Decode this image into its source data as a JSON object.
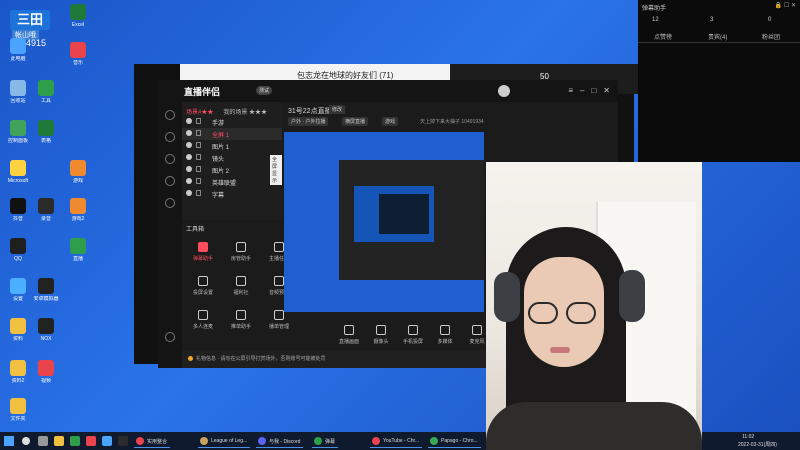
{
  "desktop": {
    "overlay_logo": "三田",
    "overlay_label": "帐山哦",
    "overlay_number": "104915",
    "icons": [
      {
        "label": "此电脑",
        "color": "#4aa3ff"
      },
      {
        "label": "回收站",
        "color": "#88b8e8"
      },
      {
        "label": "控制面板",
        "color": "#3fa35a"
      },
      {
        "label": "Microsoft",
        "color": "#ffd23f"
      },
      {
        "label": "抖音",
        "color": "#111111"
      },
      {
        "label": "QQ",
        "color": "#1f1f1f"
      },
      {
        "label": "设置",
        "color": "#4bb0ff"
      },
      {
        "label": "资料",
        "color": "#f1c040"
      },
      {
        "label": "资料2",
        "color": "#f1c040"
      },
      {
        "label": "文件夹",
        "color": "#f1c040"
      },
      {
        "label": "安卓模拟器",
        "color": "#222222"
      },
      {
        "label": "NOX",
        "color": "#222222"
      },
      {
        "label": "工具",
        "color": "#2e9e4a"
      },
      {
        "label": "Excel",
        "color": "#1f7a3a"
      },
      {
        "label": "表格",
        "color": "#1f7a3a"
      },
      {
        "label": "游戏",
        "color": "#ef8a2f"
      },
      {
        "label": "音乐",
        "color": "#e9434c"
      },
      {
        "label": "游戏2",
        "color": "#ef8a2f"
      },
      {
        "label": "直播",
        "color": "#2e9e4a"
      },
      {
        "label": "录音",
        "color": "#2b2b2b"
      },
      {
        "label": "视频",
        "color": "#e9434c"
      }
    ]
  },
  "back_window": {
    "chat_title": "包志龙在地球的好友们 (71)",
    "stat": "50"
  },
  "app": {
    "brand": "直播伴侣",
    "tag": "测试",
    "scene_tabs": [
      "场景#★★",
      "我的场景 ★★★"
    ],
    "sources": [
      {
        "name": "手游",
        "selected": false
      },
      {
        "name": "全屏 1",
        "selected": true
      },
      {
        "name": "图片 1",
        "selected": false
      },
      {
        "name": "镜头",
        "selected": false
      },
      {
        "name": "图片 2",
        "selected": false
      },
      {
        "name": "英雄联盟",
        "selected": false
      },
      {
        "name": "字幕",
        "selected": false
      }
    ],
    "tooltip": "全屏显示",
    "tools_title": "工具箱",
    "tools": [
      {
        "label": "弹幕助手",
        "hot": true
      },
      {
        "label": "房管助手",
        "hot": false
      },
      {
        "label": "主播任务",
        "hot": false
      },
      {
        "label": "投屏设置",
        "hot": false
      },
      {
        "label": "福利社",
        "hot": false
      },
      {
        "label": "音频预览",
        "hot": false
      },
      {
        "label": "多人连麦",
        "hot": false
      },
      {
        "label": "推单助手",
        "hot": false
      },
      {
        "label": "播单管理",
        "hot": false
      }
    ],
    "stream_title": "31号22点直播",
    "edit": "修改",
    "pills": [
      "户外 · 户外拉播",
      "横屏直播",
      "游戏"
    ],
    "stream_meta": "天上掉下来大柚子  10491934",
    "bottom_tools": [
      "直播画面",
      "摄像头",
      "手机投屏",
      "多媒体",
      "麦克风"
    ],
    "notice": "礼物信息 · 请勿在公屏引导打赏场外，否则账号可能被处罚"
  },
  "chat_panel": {
    "title": "弹幕助手",
    "stats": [
      "12",
      "3",
      "0"
    ],
    "tabs": [
      "点赞榜",
      "贵宾(4)",
      "粉丝团"
    ]
  },
  "taskbar": {
    "items": [
      {
        "label": "实用整合",
        "color": "#e9434c"
      },
      {
        "label": "League of Leg...",
        "color": "#c8a25a"
      },
      {
        "label": "与我 - Discord",
        "color": "#5865f2"
      },
      {
        "label": "弹幕",
        "color": "#2e9e4a"
      },
      {
        "label": "YouTube - Chr...",
        "color": "#e9434c"
      },
      {
        "label": "Papago - Chro...",
        "color": "#34a853"
      }
    ],
    "time": "11:02",
    "date": "2022-03-31(周四)"
  }
}
